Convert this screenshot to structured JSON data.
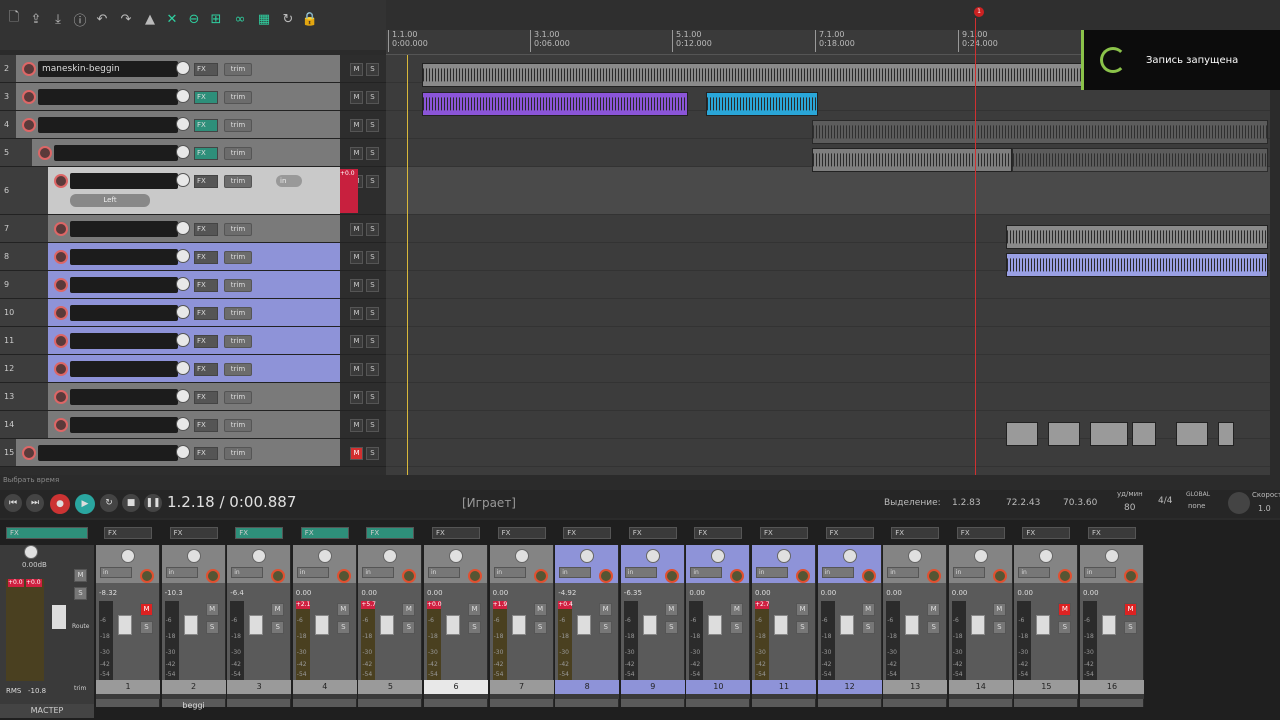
{
  "toolbar": {
    "icons": [
      "new-project-icon",
      "open-icon",
      "save-icon",
      "project-info-icon",
      "undo-icon",
      "redo-icon",
      "metronome-icon",
      "ripple-edit-icon",
      "grid-snap-icon",
      "item-grouping-icon",
      "envelope-link-icon",
      "loop-icon",
      "lock-icon"
    ]
  },
  "ruler": {
    "marks": [
      {
        "bar": "1.1.00",
        "time": "0:00.000"
      },
      {
        "bar": "3.1.00",
        "time": "0:06.000"
      },
      {
        "bar": "5.1.00",
        "time": "0:12.000"
      },
      {
        "bar": "7.1.00",
        "time": "0:18.000"
      },
      {
        "bar": "9.1.00",
        "time": "0:24.000"
      }
    ],
    "marker_label": "1"
  },
  "notification": {
    "text": "Запись запущена"
  },
  "tracks": [
    {
      "num": "2",
      "name": "maneskin-beggin",
      "fx": "FX",
      "trim": "trim"
    },
    {
      "num": "3",
      "name": "",
      "fx": "FX",
      "trim": "trim"
    },
    {
      "num": "4",
      "name": "",
      "fx": "FX",
      "trim": "trim"
    },
    {
      "num": "5",
      "name": "",
      "fx": "FX",
      "trim": "trim"
    },
    {
      "num": "6",
      "name": "",
      "fx": "FX",
      "trim": "trim",
      "input": "in",
      "channel": "Left",
      "meter": "+0.0"
    },
    {
      "num": "7",
      "name": "",
      "fx": "FX",
      "trim": "trim"
    },
    {
      "num": "8",
      "name": "",
      "fx": "FX",
      "trim": "trim"
    },
    {
      "num": "9",
      "name": "",
      "fx": "FX",
      "trim": "trim"
    },
    {
      "num": "10",
      "name": "",
      "fx": "FX",
      "trim": "trim"
    },
    {
      "num": "11",
      "name": "",
      "fx": "FX",
      "trim": "trim"
    },
    {
      "num": "12",
      "name": "",
      "fx": "FX",
      "trim": "trim"
    },
    {
      "num": "13",
      "name": "",
      "fx": "FX",
      "trim": "trim"
    },
    {
      "num": "14",
      "name": "",
      "fx": "FX",
      "trim": "trim"
    },
    {
      "num": "15",
      "name": "",
      "fx": "FX",
      "trim": "trim"
    }
  ],
  "mute_label": "M",
  "solo_label": "S",
  "hint": "Выбрать время",
  "transport": {
    "position": "1.2.18 / 0:00.887",
    "state": "[Играет]",
    "selection_label": "Выделение:",
    "sel_start": "1.2.83",
    "sel_end": "72.2.43",
    "sel_len": "70.3.60",
    "bpm_label": "уд/мин",
    "bpm": "80",
    "timesig": "4/4",
    "global_label": "GLOBAL",
    "global_mode": "none",
    "rate_label": "Скорост",
    "rate": "1.0"
  },
  "master": {
    "label": "МАСТЕР",
    "fx": "FX",
    "vol": "0.00dB",
    "peak_l": "+0.0",
    "peak_r": "+0.0",
    "rms_label": "RMS",
    "rms": "-10.8",
    "route": "Route",
    "trim": "trim",
    "scale": [
      "12",
      "6",
      "0",
      "-6",
      "-12",
      "-18",
      "-24",
      "-30",
      "-36",
      "-42",
      "-48",
      "-54"
    ]
  },
  "mixer_strips": [
    {
      "num": "1",
      "vol": "-8.32",
      "name": "",
      "mute": true
    },
    {
      "num": "2",
      "vol": "-10.3",
      "name": "maneskin-beggi",
      "mute": false
    },
    {
      "num": "3",
      "vol": "-6.4",
      "name": "",
      "mute": false
    },
    {
      "num": "4",
      "vol": "0.00",
      "name": "",
      "mute": false,
      "peak": "+2.1"
    },
    {
      "num": "5",
      "vol": "0.00",
      "name": "",
      "mute": false,
      "peak": "+5.7"
    },
    {
      "num": "6",
      "vol": "0.00",
      "name": "",
      "mute": false,
      "peak": "+0.0"
    },
    {
      "num": "7",
      "vol": "0.00",
      "name": "",
      "mute": false,
      "peak": "+1.9"
    },
    {
      "num": "8",
      "vol": "-4.92",
      "name": "",
      "mute": false,
      "peak": "+0.4"
    },
    {
      "num": "9",
      "vol": "-6.35",
      "name": "",
      "mute": false
    },
    {
      "num": "10",
      "vol": "0.00",
      "name": "",
      "mute": false
    },
    {
      "num": "11",
      "vol": "0.00",
      "name": "",
      "mute": false,
      "peak": "+2.7"
    },
    {
      "num": "12",
      "vol": "0.00",
      "name": "",
      "mute": false
    },
    {
      "num": "13",
      "vol": "0.00",
      "name": "",
      "mute": false
    },
    {
      "num": "14",
      "vol": "0.00",
      "name": "",
      "mute": false
    },
    {
      "num": "15",
      "vol": "0.00",
      "name": "",
      "mute": true
    },
    {
      "num": "16",
      "vol": "0.00",
      "name": "",
      "mute": true
    }
  ],
  "meter_scale": [
    "-6",
    "-18",
    "-30",
    "-42",
    "-54"
  ],
  "strip_in": "in",
  "strip_fx": "FX",
  "colors": {
    "accent_green": "#2e8f7a",
    "track_blue": "#8e93d8",
    "record_red": "#d23030",
    "cursor": "#d03030",
    "notif_border": "#8bc34a"
  }
}
